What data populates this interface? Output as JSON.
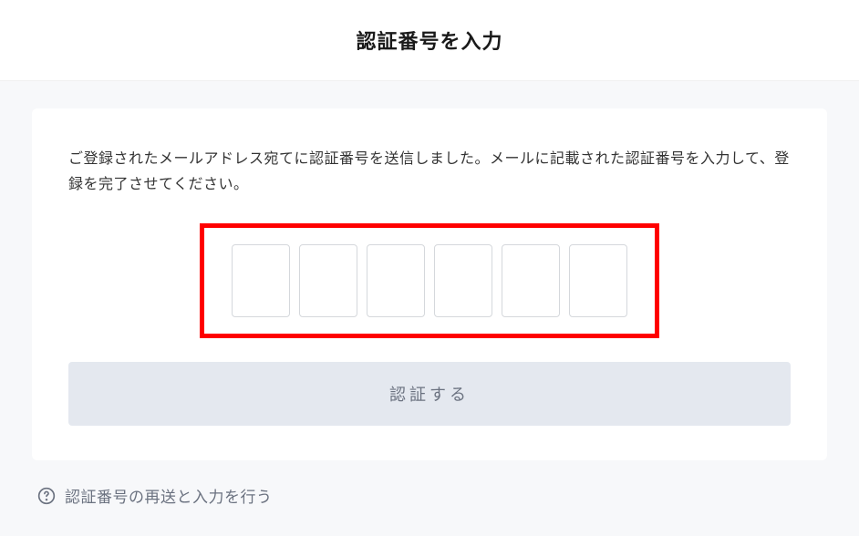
{
  "header": {
    "title": "認証番号を入力"
  },
  "card": {
    "instruction": "ご登録されたメールアドレス宛てに認証番号を送信しました。メールに記載された認証番号を入力して、登録を完了させてください。",
    "code_length": 6,
    "verify_button_label": "認証する"
  },
  "resend": {
    "label": "認証番号の再送と入力を行う"
  },
  "colors": {
    "highlight_border": "#ff0000",
    "button_bg": "#e4e8ef",
    "text_muted": "#6b7280"
  }
}
